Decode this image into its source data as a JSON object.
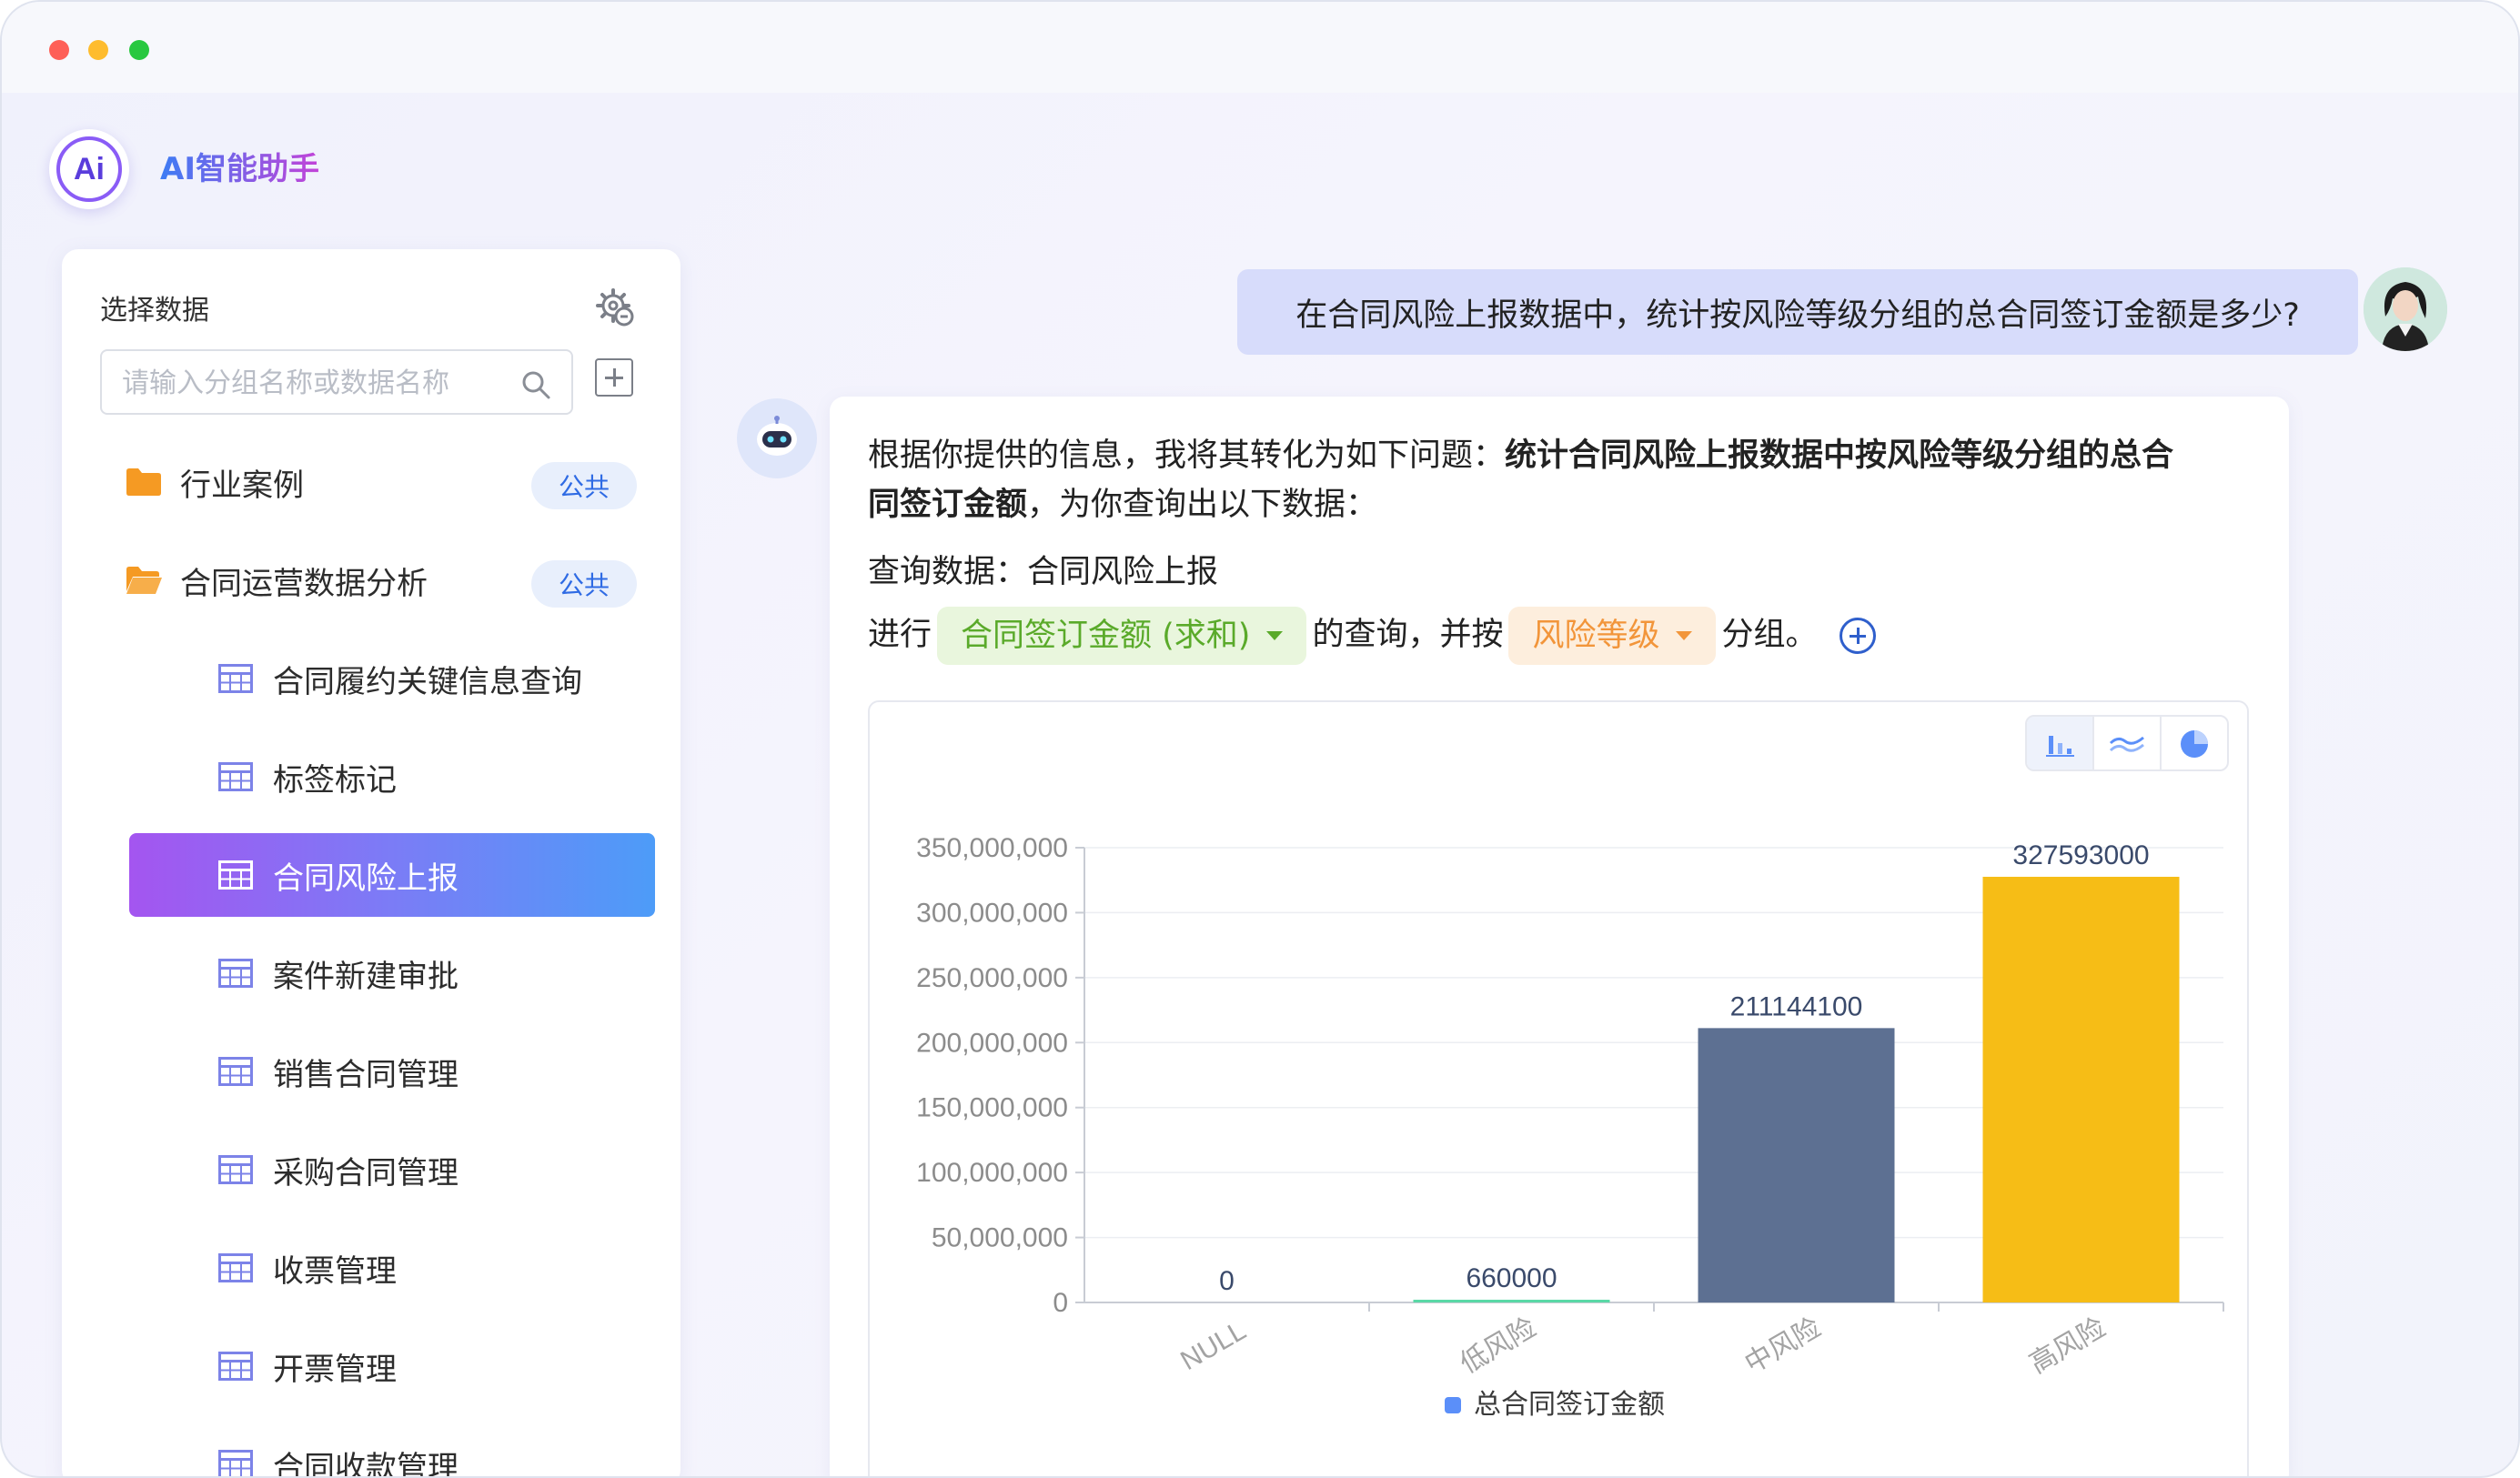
{
  "app": {
    "title": "AI智能助手",
    "logo_text": "Ai"
  },
  "sidebar": {
    "title": "选择数据",
    "search_placeholder": "请输入分组名称或数据名称",
    "groups": [
      {
        "label": "行业案例",
        "badge": "公共"
      },
      {
        "label": "合同运营数据分析",
        "badge": "公共"
      }
    ],
    "tables": [
      "合同履约关键信息查询",
      "标签标记",
      "合同风险上报",
      "案件新建审批",
      "销售合同管理",
      "采购合同管理",
      "收票管理",
      "开票管理",
      "合同收款管理"
    ],
    "active_table": "合同风险上报"
  },
  "chat": {
    "user_question": "在合同风险上报数据中，统计按风险等级分组的总合同签订金额是多少?",
    "answer_intro_1": "根据你提供的信息，我将其转化为如下问题：",
    "answer_bold_1": "统计合同风险上报数据中按风险等级分组的总合",
    "answer_bold_2": "同签订金额",
    "answer_intro_2": "，为你查询出以下数据：",
    "query_data_line": "查询数据：合同风险上报",
    "query_prefix": "进行",
    "metric_chip": "合同签订金额 (求和)",
    "query_mid": "的查询，并按",
    "group_chip": "风险等级",
    "query_suffix": "分组。"
  },
  "chart_data": {
    "type": "bar",
    "categories": [
      "NULL",
      "低风险",
      "中风险",
      "高风险"
    ],
    "series": [
      {
        "name": "总合同签订金额",
        "values": [
          0,
          660000,
          211144100,
          327593000
        ]
      }
    ],
    "data_labels": [
      "0",
      "660000",
      "211144100",
      "327593000"
    ],
    "yticks": [
      "0",
      "50,000,000",
      "100,000,000",
      "150,000,000",
      "200,000,000",
      "250,000,000",
      "300,000,000",
      "350,000,000"
    ],
    "ylim": [
      0,
      350000000
    ],
    "bar_colors": [
      "#5b8ff9",
      "#5ad8a6",
      "#5d7092",
      "#f6bd16"
    ],
    "legend_color": "#5b8ff9",
    "legend_position": "bottom"
  },
  "chart_toggle": [
    "bar-chart-icon",
    "line-chart-icon",
    "pie-chart-icon"
  ]
}
